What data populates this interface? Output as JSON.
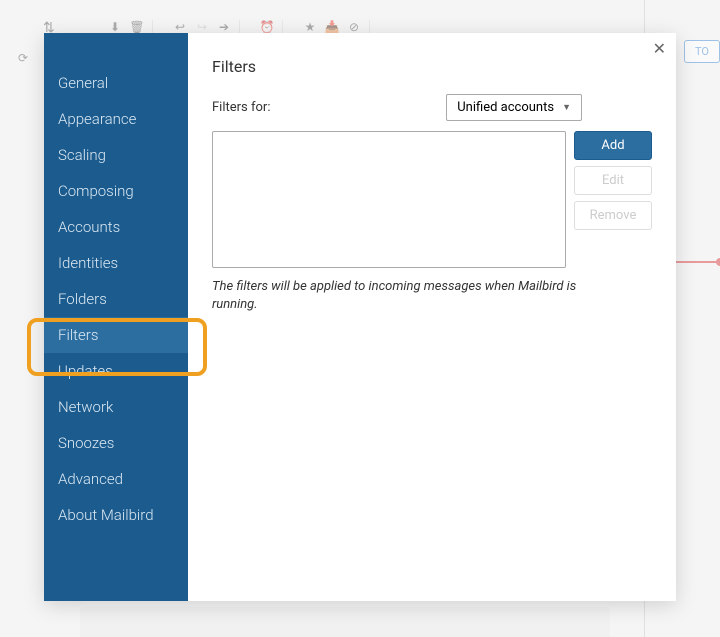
{
  "toolbar_bg": {
    "today": "TO"
  },
  "sidebar": {
    "items": [
      {
        "label": "General"
      },
      {
        "label": "Appearance"
      },
      {
        "label": "Scaling"
      },
      {
        "label": "Composing"
      },
      {
        "label": "Accounts"
      },
      {
        "label": "Identities"
      },
      {
        "label": "Folders"
      },
      {
        "label": "Filters",
        "selected": true
      },
      {
        "label": "Updates"
      },
      {
        "label": "Network"
      },
      {
        "label": "Snoozes"
      },
      {
        "label": "Advanced"
      },
      {
        "label": "About Mailbird"
      }
    ]
  },
  "panel": {
    "title": "Filters",
    "filters_for_label": "Filters for:",
    "account_dropdown": "Unified accounts",
    "buttons": {
      "add": "Add",
      "edit": "Edit",
      "remove": "Remove"
    },
    "help": "The filters will be applied to incoming messages when Mailbird is running."
  }
}
